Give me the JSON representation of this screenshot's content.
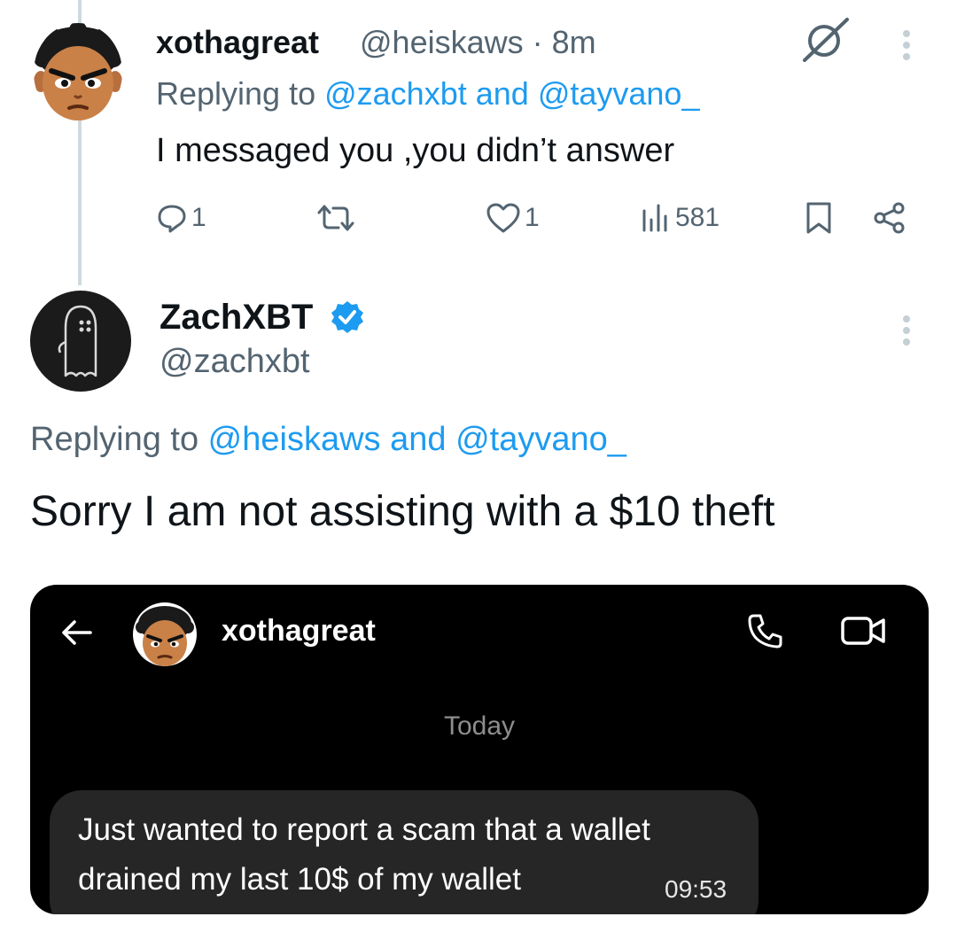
{
  "tweet1": {
    "name": "xothagreat",
    "handle_time": "@heiskaws · 8m",
    "replying_prefix": "Replying to ",
    "replying_user1": "@zachxbt",
    "replying_and": " and ",
    "replying_user2": "@tayvano_",
    "text": "I messaged you ,you didn’t answer",
    "replies": "1",
    "likes": "1",
    "views": "581",
    "icons": [
      "grok-icon",
      "more-icon",
      "reply-icon",
      "retweet-icon",
      "like-icon",
      "views-icon",
      "bookmark-icon",
      "share-icon"
    ]
  },
  "tweet2": {
    "name": "ZachXBT",
    "handle": "@zachxbt",
    "replying_prefix": "Replying to ",
    "replying_user1": "@heiskaws",
    "replying_and": " and ",
    "replying_user2": "@tayvano_",
    "text": "Sorry I am not assisting with a $10 theft",
    "verified_color": "#1d9bf0"
  },
  "embed": {
    "contact_name": "xothagreat",
    "date_divider": "Today",
    "message_line1": "Just wanted to report a scam that a wallet",
    "message_line2": "drained my last 10$  of my wallet",
    "message_time": "09:53",
    "icons": [
      "back-arrow-icon",
      "phone-icon",
      "video-call-icon"
    ]
  },
  "colors": {
    "link": "#1d9bf0",
    "secondary_text": "#536471",
    "embed_bg": "#000000",
    "bubble_bg": "#262626"
  }
}
